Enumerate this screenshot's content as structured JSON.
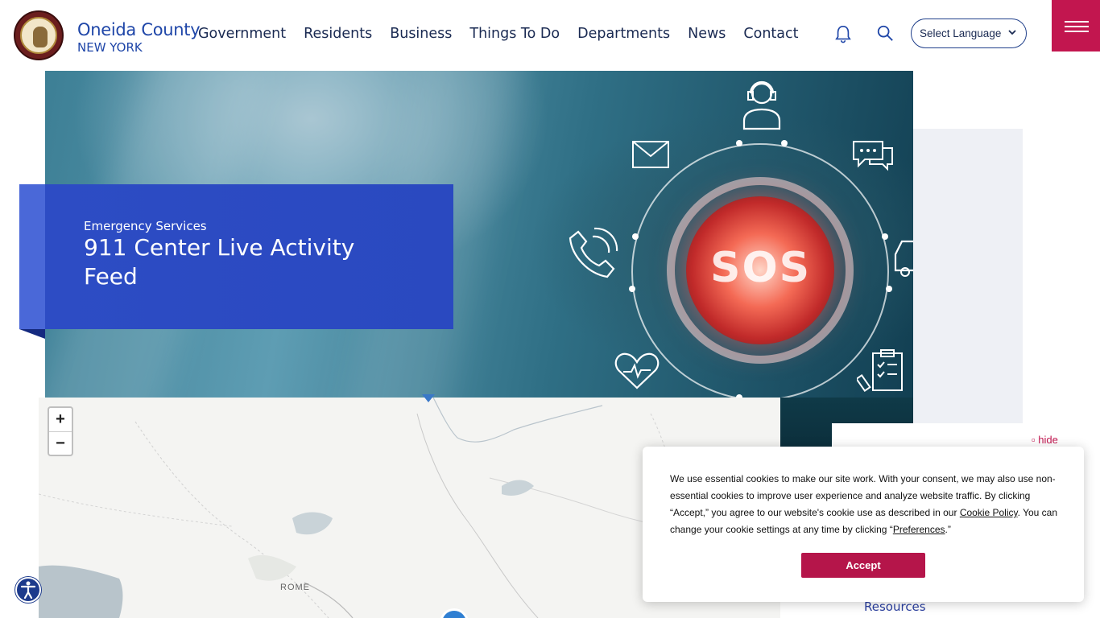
{
  "header": {
    "county_name": "Oneida County",
    "county_state": "NEW YORK",
    "nav": [
      "Government",
      "Residents",
      "Business",
      "Things To Do",
      "Departments",
      "News",
      "Contact"
    ],
    "language_label": "Select Language",
    "colors": {
      "brand": "#1f46a8",
      "menu": "#c2164f"
    }
  },
  "hero": {
    "kicker": "Emergency Services",
    "title": "911 Center Live Activity Feed",
    "sos_text": "SOS"
  },
  "map": {
    "city_label": "ROME",
    "zoom_in": "+",
    "zoom_out": "−"
  },
  "sidebar": {
    "hide_label": "▫ hide",
    "resources_label": "Resources"
  },
  "cookie": {
    "text_1": "We use essential cookies to make our site work. With your consent, we may also use non-essential cookies to improve user experience and analyze website traffic. By clicking “Accept,” you agree to our website's cookie use as described in our ",
    "policy_link": "Cookie Policy",
    "text_2": ". You can change your cookie settings at any time by clicking “",
    "preferences_link": "Preferences",
    "text_3": ".”",
    "accept_label": "Accept"
  }
}
